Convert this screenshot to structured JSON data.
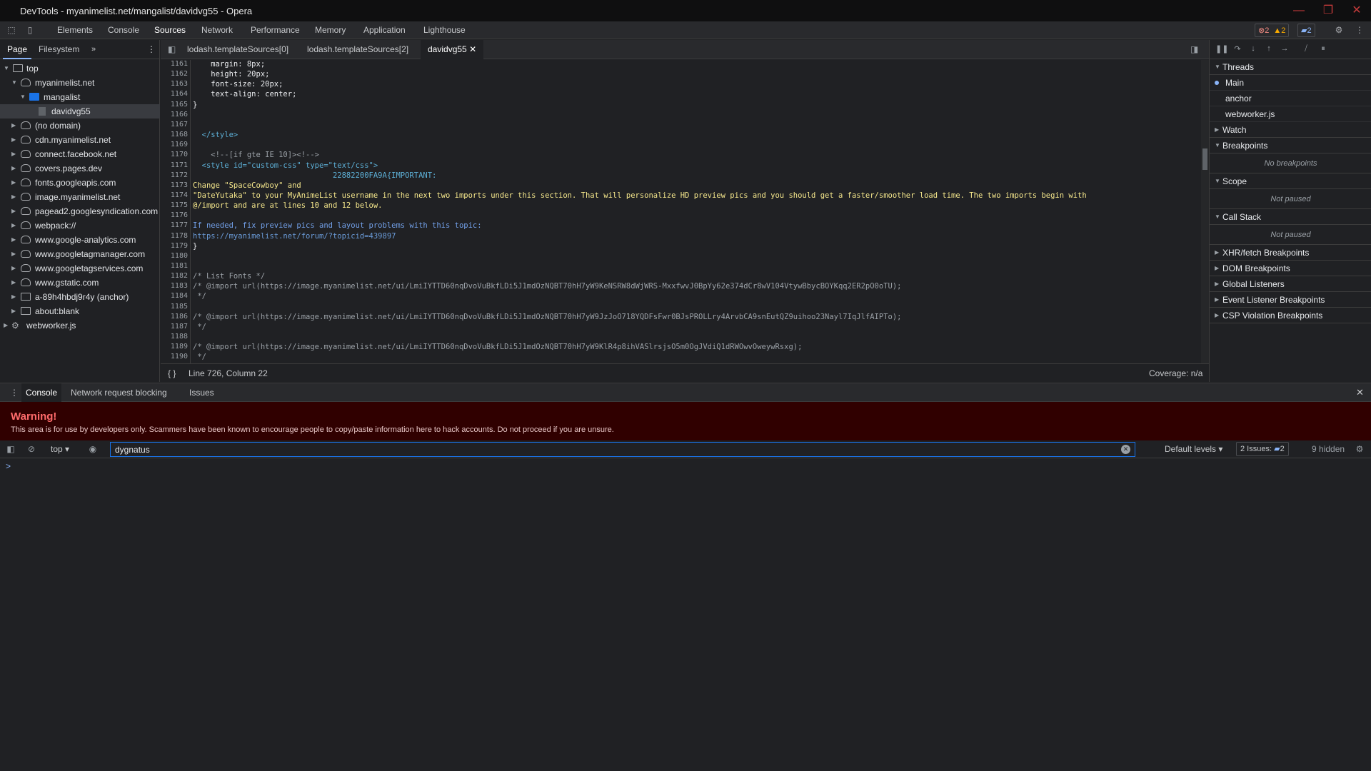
{
  "window": {
    "title": "DevTools - myanimelist.net/mangalist/davidvg55 - Opera",
    "controls": [
      "minimize",
      "restore",
      "close"
    ]
  },
  "main_tabs": [
    "Elements",
    "Console",
    "Sources",
    "Network",
    "Performance",
    "Memory",
    "Application",
    "Lighthouse"
  ],
  "active_main_tab": "Sources",
  "counters": {
    "errors": "2",
    "warnings": "2",
    "messages": "2"
  },
  "navigator": {
    "tabs": [
      "Page",
      "Filesystem"
    ],
    "tree": [
      {
        "label": "top"
      },
      {
        "label": "myanimelist.net"
      },
      {
        "label": "mangalist"
      },
      {
        "label": "davidvg55"
      },
      {
        "label": "(no domain)"
      },
      {
        "label": "cdn.myanimelist.net"
      },
      {
        "label": "connect.facebook.net"
      },
      {
        "label": "covers.pages.dev"
      },
      {
        "label": "fonts.googleapis.com"
      },
      {
        "label": "image.myanimelist.net"
      },
      {
        "label": "pagead2.googlesyndication.com"
      },
      {
        "label": "webpack://"
      },
      {
        "label": "www.google-analytics.com"
      },
      {
        "label": "www.googletagmanager.com"
      },
      {
        "label": "www.googletagservices.com"
      },
      {
        "label": "www.gstatic.com"
      },
      {
        "label": "a-89h4hbdj9r4y (anchor)"
      },
      {
        "label": "about:blank"
      },
      {
        "label": "webworker.js"
      }
    ]
  },
  "editor": {
    "tabs": [
      "lodash.templateSources[0]",
      "lodash.templateSources[2]",
      "davidvg55"
    ],
    "line_numbers": [
      "1161",
      "1162",
      "1163",
      "1164",
      "1165",
      "1166",
      "1167",
      "1168",
      "1169",
      "1170",
      "1171",
      "1172",
      "1173",
      "1174",
      "1175",
      "1176",
      "1177",
      "1178",
      "1179",
      "1180",
      "1181",
      "1182",
      "1183",
      "1184",
      "1185",
      "1186",
      "1187",
      "1188",
      "1189",
      "1190"
    ],
    "lines": [
      "    margin: 8px;",
      "    height: 20px;",
      "    font-size: 20px;",
      "    text-align: center;",
      "}",
      "",
      "",
      "  </style>",
      "",
      "    <!--[if gte IE 10]><!-->",
      "  <style id=\"custom-css\" type=\"text/css\">",
      "                               22882200FA9A{IMPORTANT:",
      "Change \"SpaceCowboy\" and",
      "\"DateYutaka\" to your MyAnimeList username in the next two imports under this section. That will personalize HD preview pics and you should get a faster/smoother load time. The two imports begin with",
      "@/import and are at lines 10 and 12 below.",
      "",
      "If needed, fix preview pics and layout problems with this topic:",
      "https://myanimelist.net/forum/?topicid=439897",
      "}",
      "",
      "",
      "/* List Fonts */",
      "/* @import url(https://image.myanimelist.net/ui/LmiIYTTD60nqDvoVuBkfLDi5J1mdOzNQBT70hH7yW9KeNSRW8dWjWRS-MxxfwvJ0BpYy62e374dCr8wV104VtywBbycBOYKqq2ER2pO0oTU);",
      " */",
      "",
      "/* @import url(https://image.myanimelist.net/ui/LmiIYTTD60nqDvoVuBkfLDi5J1mdOzNQBT70hH7yW9JzJoO718YQDFsFwr0BJsPROLLry4ArvbCA9snEutQZ9uihoo23Nayl7IqJlfAIPTo);",
      " */",
      "",
      "/* @import url(https://image.myanimelist.net/ui/LmiIYTTD60nqDvoVuBkfLDi5J1mdOzNQBT70hH7yW9KlR4p8ihVASlrsjsO5m0OgJVdiQ1dRWOwvOweywRsxg);",
      " */"
    ],
    "status_position": "Line 726, Column 22",
    "coverage": "Coverage: n/a"
  },
  "debugger": {
    "threads_label": "Threads",
    "threads": [
      "Main",
      "anchor",
      "webworker.js"
    ],
    "watch": "Watch",
    "breakpoints": "Breakpoints",
    "no_breakpoints": "No breakpoints",
    "scope": "Scope",
    "scope_note": "Not paused",
    "call_stack": "Call Stack",
    "call_stack_note": "Not paused",
    "collapsed_sections": [
      "XHR/fetch Breakpoints",
      "DOM Breakpoints",
      "Global Listeners",
      "Event Listener Breakpoints",
      "CSP Violation Breakpoints"
    ]
  },
  "drawer": {
    "tabs": [
      "Console",
      "Network request blocking",
      "Issues"
    ],
    "warning_title": "Warning!",
    "warning_message": "This area is for use by developers only. Scammers have been known to encourage people to copy/paste information here to hack accounts. Do not proceed if you are unsure.",
    "context": "top",
    "filter_value": "dygnatus",
    "levels": "Default levels",
    "issues_label": "2 Issues:",
    "issues_count": "2",
    "hidden": "9 hidden",
    "prompt": ">"
  },
  "colors": {
    "accent": "#1a73e8",
    "warning_bg": "#300000",
    "warning_title": "#ff6b6b"
  }
}
